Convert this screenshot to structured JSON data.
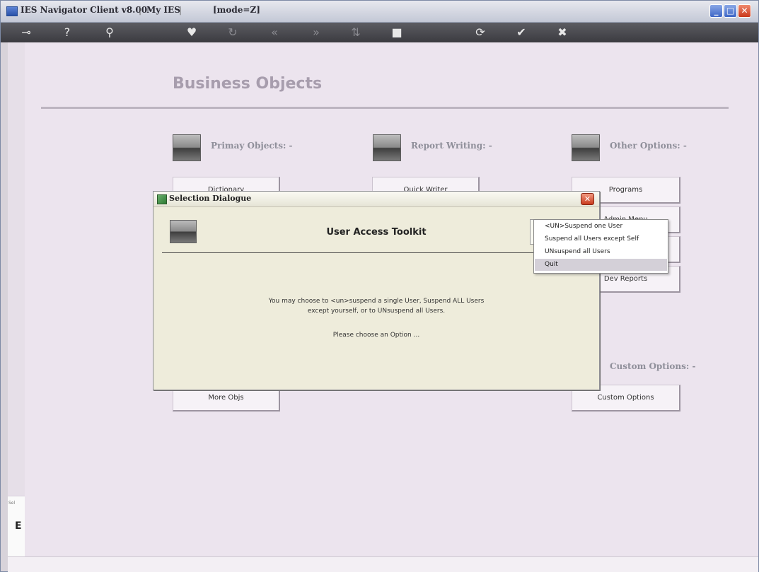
{
  "window": {
    "title_parts": [
      "IES Navigator Client v8.00",
      "My IES",
      "[mode=Z]"
    ],
    "buttons": {
      "minimize": "_",
      "maximize": "□",
      "close": "✕"
    }
  },
  "toolbar": {
    "icons": [
      {
        "name": "key-icon",
        "glyph": "⊸"
      },
      {
        "name": "help-icon",
        "glyph": "?"
      },
      {
        "name": "search-icon",
        "glyph": "⚲"
      },
      {
        "name": "heart-icon",
        "glyph": "♥"
      },
      {
        "name": "refresh-icon",
        "glyph": "↻"
      },
      {
        "name": "rewind-icon",
        "glyph": "«"
      },
      {
        "name": "forward-icon",
        "glyph": "»"
      },
      {
        "name": "sort-icon",
        "glyph": "⇅"
      },
      {
        "name": "stop-icon",
        "glyph": "■"
      },
      {
        "name": "reload-icon",
        "glyph": "⟳"
      },
      {
        "name": "check-icon",
        "glyph": "✔"
      },
      {
        "name": "close-icon",
        "glyph": "✖"
      }
    ]
  },
  "page": {
    "title": "Business Objects",
    "sections": {
      "primary": "Primay Objects: -",
      "report": "Report Writing: -",
      "other": "Other Options: -",
      "custom": "Custom Options: -"
    },
    "buttons": {
      "dictionary": "Dictionary",
      "quickwriter": "Quick Writer",
      "programs": "Programs",
      "admin": "Admin Menu",
      "dev_reports": "Dev Reports",
      "more_objs": "More Objs",
      "custom_options": "Custom Options"
    }
  },
  "sidebar": {
    "label": "Sel",
    "letter": "E"
  },
  "dialog": {
    "title": "Selection Dialogue",
    "heading": "User Access Toolkit",
    "message_line1": "You may choose to <un>suspend a single User, Suspend ALL Users",
    "message_line2": "except yourself, or to UNsuspend all Users.",
    "message_line3": "Please choose an Option ..."
  },
  "dropdown": {
    "items": [
      "<UN>Suspend one User",
      "Suspend all Users except Self",
      "UNsuspend all Users",
      "Quit"
    ],
    "selected_index": 3
  },
  "colors": {
    "background": "#ece4ee",
    "dialog_bg": "#eeecdb",
    "toolbar": "#47474c",
    "heading": "#a79dad"
  }
}
